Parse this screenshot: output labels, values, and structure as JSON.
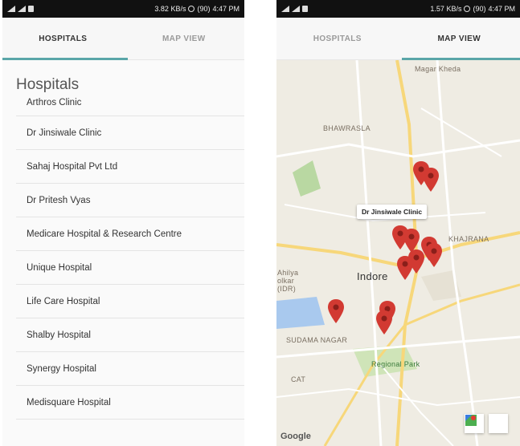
{
  "left": {
    "status": {
      "speed": "3.82 KB/s",
      "battery": "(90)",
      "time": "4:47 PM"
    },
    "tabs": [
      "HOSPITALS",
      "MAP VIEW"
    ],
    "title": "Hospitals",
    "hospitals": [
      "Arthros Clinic",
      "Dr Jinsiwale Clinic",
      "Sahaj Hospital Pvt Ltd",
      "Dr Pritesh Vyas",
      "Medicare Hospital & Research Centre",
      "Unique Hospital",
      "Life Care Hospital",
      "Shalby Hospital",
      "Synergy Hospital",
      "Medisquare Hospital"
    ]
  },
  "right": {
    "status": {
      "speed": "1.57 KB/s",
      "battery": "(90)",
      "time": "4:47 PM"
    },
    "tabs": [
      "HOSPITALS",
      "MAP VIEW"
    ],
    "map": {
      "labels": {
        "magar_kheda": "Magar Kheda",
        "bhawrasla": "BHAWRASLA",
        "khajrana": "KHAJRANA",
        "indore": "Indore",
        "sudama_nagar": "SUDAMA NAGAR",
        "regional_park": "Regional Park",
        "cat": "CAT",
        "ahilya": "Ahilya",
        "holkar": "olkar",
        "idr": "(IDR)"
      },
      "tooltip": "Dr Jinsiwale Clinic",
      "google": "Google"
    }
  }
}
